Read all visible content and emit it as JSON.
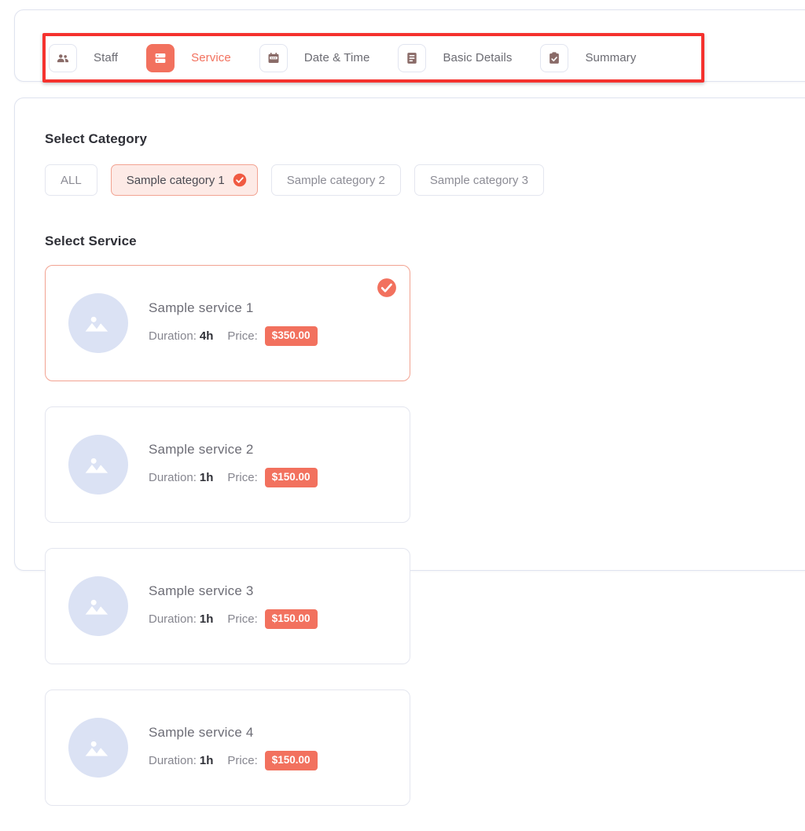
{
  "theme": {
    "accent": "#f2715e",
    "accent_strong": "#f5322e",
    "selected_chip_bg": "#fdeae6",
    "selected_chip_border": "#f2a392",
    "card_border": "#e4e6ef",
    "thumb_bg": "#dbe2f4",
    "text_muted": "#86868f",
    "text_dark": "#2f3037"
  },
  "steps": {
    "focus_ring": "highlighted-step-bar",
    "items": [
      {
        "label": "Staff",
        "icon": "people-icon",
        "active": false
      },
      {
        "label": "Service",
        "icon": "server-icon",
        "active": true
      },
      {
        "label": "Date & Time",
        "icon": "calendar-icon",
        "active": false
      },
      {
        "label": "Basic Details",
        "icon": "document-icon",
        "active": false
      },
      {
        "label": "Summary",
        "icon": "clipboard-check-icon",
        "active": false
      }
    ]
  },
  "main": {
    "category_title": "Select Category",
    "service_title": "Select Service",
    "categories": [
      {
        "label": "ALL",
        "selected": false
      },
      {
        "label": "Sample category 1",
        "selected": true
      },
      {
        "label": "Sample category 2",
        "selected": false
      },
      {
        "label": "Sample category 3",
        "selected": false
      }
    ],
    "duration_label": "Duration:",
    "price_label": "Price:",
    "services": [
      {
        "name": "Sample service 1",
        "duration": "4h",
        "price": "$350.00",
        "selected": true,
        "thumb": "image-placeholder-icon"
      },
      {
        "name": "Sample service 2",
        "duration": "1h",
        "price": "$150.00",
        "selected": false,
        "thumb": "image-placeholder-icon"
      },
      {
        "name": "Sample service 3",
        "duration": "1h",
        "price": "$150.00",
        "selected": false,
        "thumb": "image-placeholder-icon"
      },
      {
        "name": "Sample service 4",
        "duration": "1h",
        "price": "$150.00",
        "selected": false,
        "thumb": "image-placeholder-icon"
      }
    ]
  }
}
